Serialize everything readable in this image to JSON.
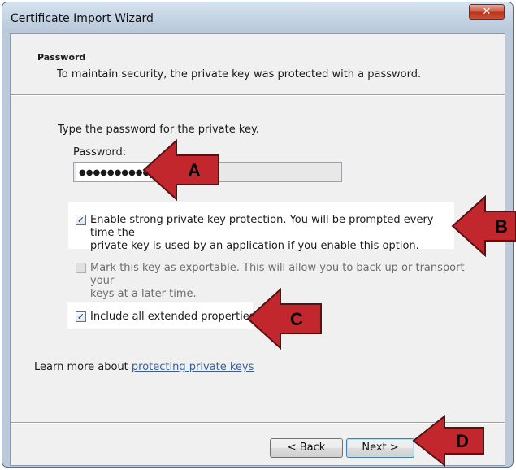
{
  "window": {
    "title": "Certificate Import Wizard",
    "close_glyph": "✕"
  },
  "header": {
    "title": "Password",
    "description": "To maintain security, the private key was protected with a password."
  },
  "body": {
    "prompt": "Type the password for the private key.",
    "password_label": "Password:",
    "password_value": "●●●●●●●●●●"
  },
  "options": [
    {
      "label_line1": "Enable strong private key protection. You will be prompted every time the",
      "label_line2": "private key is used by an application if you enable this option.",
      "checked": true,
      "enabled": true
    },
    {
      "label_line1": "Mark this key as exportable. This will allow you to back up or transport your",
      "label_line2": "keys at a later time.",
      "checked": false,
      "enabled": false
    },
    {
      "label_line1": "Include all extended properties.",
      "checked": true,
      "enabled": true
    }
  ],
  "learn_more": {
    "prefix": "Learn more about ",
    "link": "protecting private keys"
  },
  "buttons": {
    "back": "< Back",
    "next": "Next >"
  },
  "callouts": {
    "a": "A",
    "b": "B",
    "c": "C",
    "d": "D",
    "color": "#c1272d"
  }
}
